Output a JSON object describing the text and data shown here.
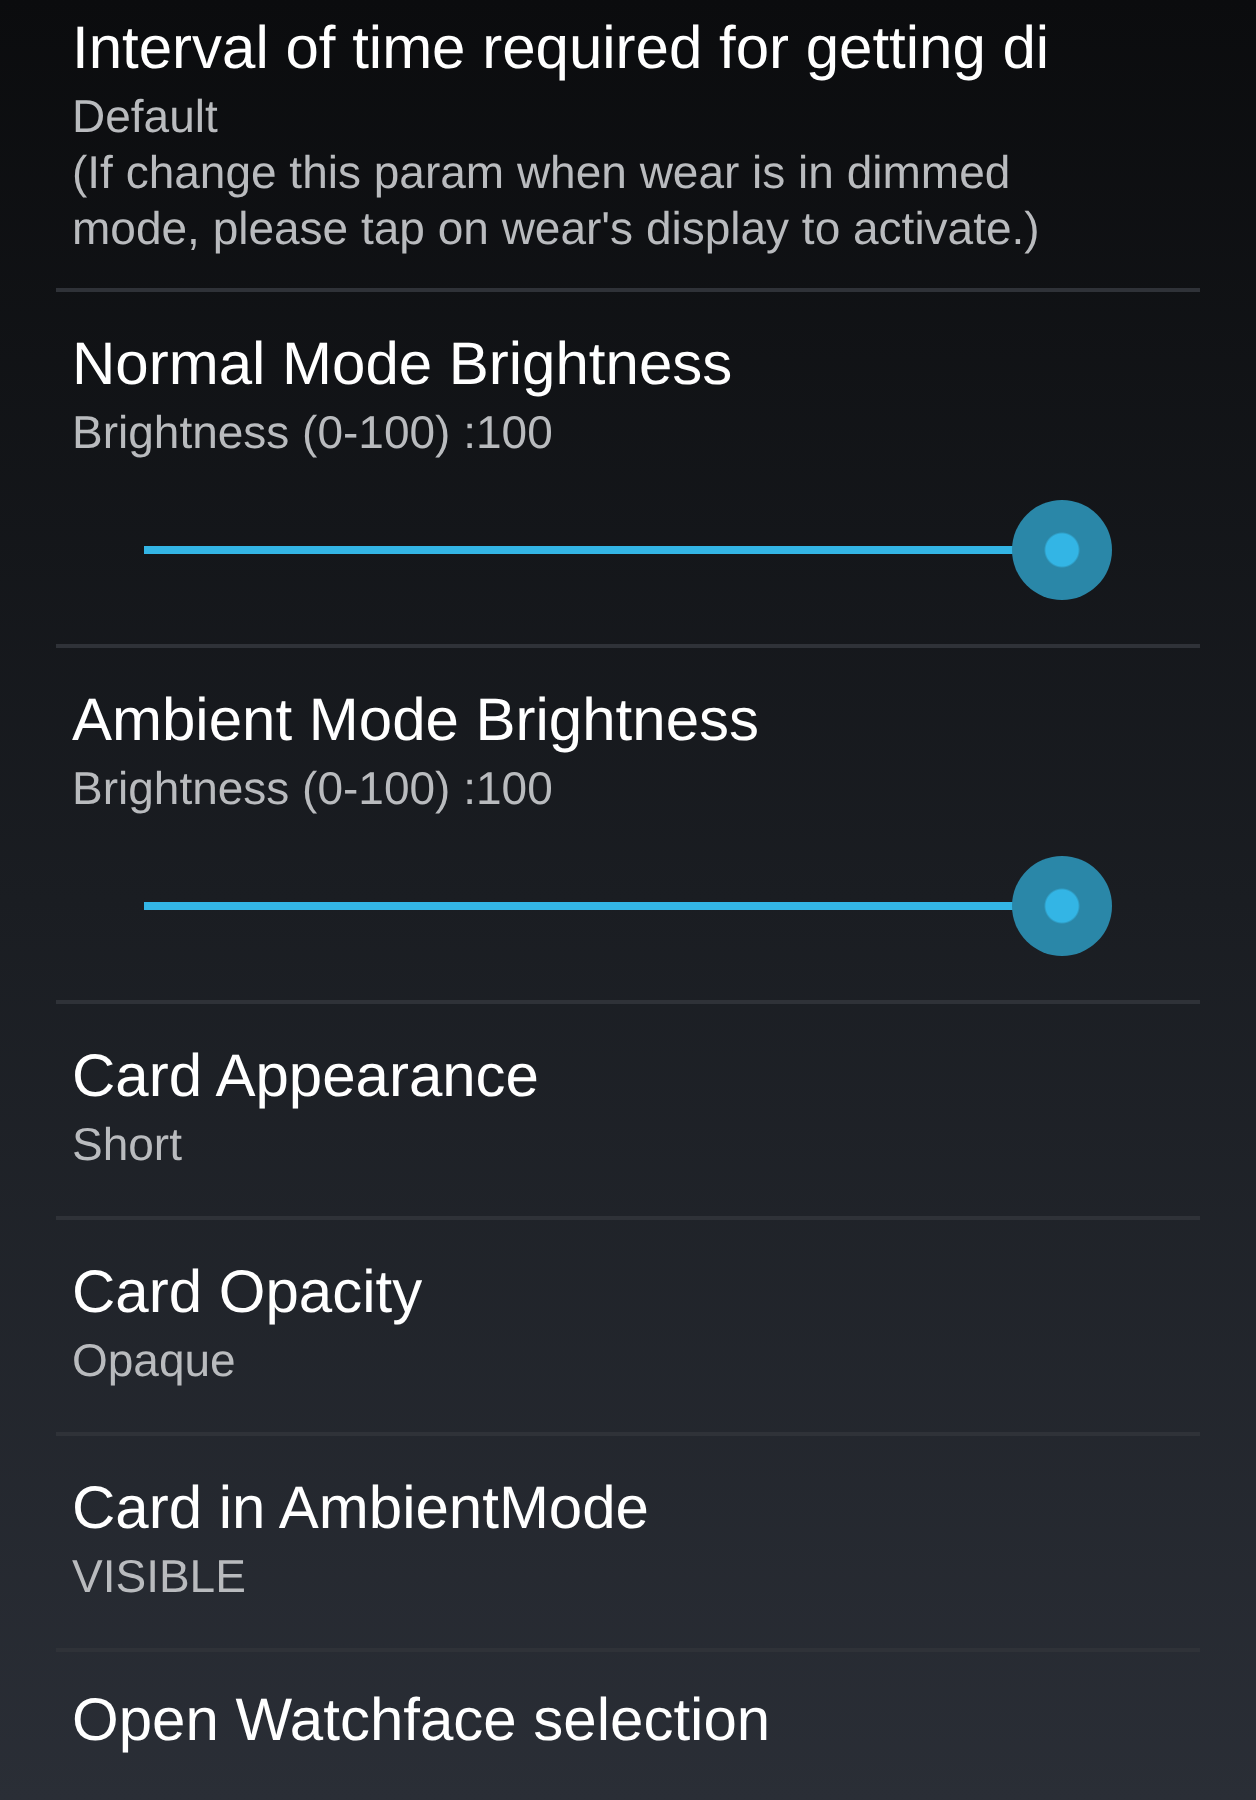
{
  "settings": [
    {
      "kind": "text",
      "title": "Interval of time required for getting di",
      "summary": "Default",
      "note": "(If change this param when wear is in dimmed mode, please tap on wear's display to activate.)"
    },
    {
      "kind": "slider",
      "title": "Normal Mode Brightness",
      "summary": "Brightness (0-100) :100",
      "level": 1
    },
    {
      "kind": "slider",
      "title": "Ambient Mode Brightness",
      "summary": "Brightness (0-100) :100",
      "level": 1
    },
    {
      "kind": "text",
      "title": "Card Appearance",
      "summary": "Short"
    },
    {
      "kind": "text",
      "title": "Card Opacity",
      "summary": "Opaque"
    },
    {
      "kind": "text",
      "title": "Card in AmbientMode",
      "summary": "VISIBLE"
    },
    {
      "kind": "text",
      "title": "Open Watchface selection"
    }
  ]
}
